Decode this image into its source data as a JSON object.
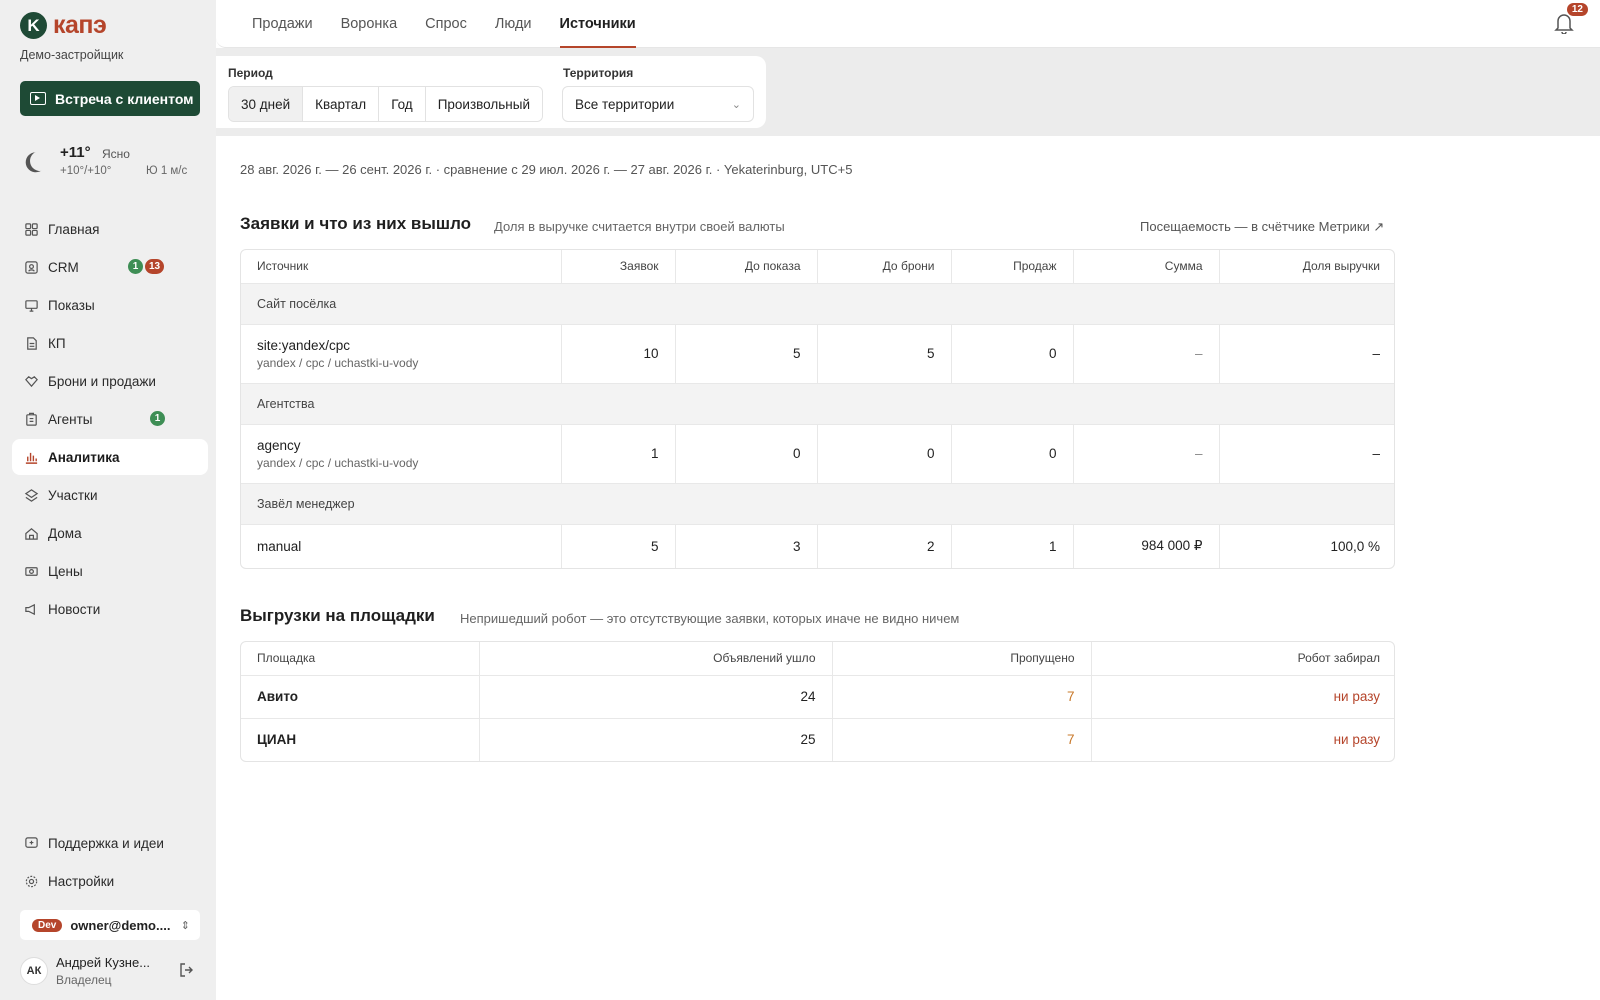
{
  "brand": {
    "logo_letter": "K",
    "logo_text": "капэ",
    "org": "Демо-застройщик"
  },
  "sidebar": {
    "meet_button": "Встреча с клиентом",
    "weather": {
      "temp": "+11°",
      "condition": "Ясно",
      "range": "+10°/+10°",
      "wind": "Ю 1 м/с"
    },
    "items": [
      {
        "label": "Главная",
        "icon": "grid-icon"
      },
      {
        "label": "CRM",
        "icon": "contact-icon",
        "badge_green": "1",
        "badge_red": "13"
      },
      {
        "label": "Показы",
        "icon": "screen-icon"
      },
      {
        "label": "КП",
        "icon": "document-icon"
      },
      {
        "label": "Брони и продажи",
        "icon": "handshake-icon"
      },
      {
        "label": "Агенты",
        "icon": "building-icon",
        "badge_green": "1"
      },
      {
        "label": "Аналитика",
        "icon": "chart-icon",
        "active": true
      },
      {
        "label": "Участки",
        "icon": "plots-icon"
      },
      {
        "label": "Дома",
        "icon": "house-icon"
      },
      {
        "label": "Цены",
        "icon": "price-icon"
      },
      {
        "label": "Новости",
        "icon": "megaphone-icon"
      }
    ],
    "support": "Поддержка и идеи",
    "settings": "Настройки",
    "account": {
      "tag": "Dev",
      "email": "owner@demo...."
    },
    "user": {
      "initials": "АК",
      "name": "Андрей Кузне...",
      "role": "Владелец"
    }
  },
  "tabs": [
    "Продажи",
    "Воронка",
    "Спрос",
    "Люди",
    "Источники"
  ],
  "active_tab": "Источники",
  "notifications": {
    "count": "12"
  },
  "filters": {
    "period_label": "Период",
    "periods": [
      "30 дней",
      "Квартал",
      "Год",
      "Произвольный"
    ],
    "active_period": "30 дней",
    "territory_label": "Территория",
    "territory_value": "Все территории"
  },
  "date_range": "28 авг. 2026 г. — 26 сент. 2026 г. · сравнение с 29 июл. 2026 г. — 27 авг. 2026 г. · Yekaterinburg, UTC+5",
  "leads": {
    "title": "Заявки и что из них вышло",
    "subtitle": "Доля в выручке считается внутри своей валюты",
    "link": "Посещаемость — в счётчике Метрики ↗",
    "columns": [
      "Источник",
      "Заявок",
      "До показа",
      "До брони",
      "Продаж",
      "Сумма",
      "Доля выручки"
    ],
    "groups": [
      {
        "name": "Сайт посёлка",
        "rows": [
          {
            "source": "site:yandex/cpc",
            "utm": "yandex / cpc / uchastki-u-vody",
            "leads": "10",
            "to_show": "5",
            "to_booking": "5",
            "sales": "0",
            "sum": "–",
            "share": "–"
          }
        ]
      },
      {
        "name": "Агентства",
        "rows": [
          {
            "source": "agency",
            "utm": "yandex / cpc / uchastki-u-vody",
            "leads": "1",
            "to_show": "0",
            "to_booking": "0",
            "sales": "0",
            "sum": "–",
            "share": "–"
          }
        ]
      },
      {
        "name": "Завёл менеджер",
        "rows": [
          {
            "source": "manual",
            "utm": "",
            "leads": "5",
            "to_show": "3",
            "to_booking": "2",
            "sales": "1",
            "sum": "984 000 ₽",
            "share": "100,0 %"
          }
        ]
      }
    ]
  },
  "exports": {
    "title": "Выгрузки на площадки",
    "subtitle": "Непришедший робот — это отсутствующие заявки, которых иначе не видно ничем",
    "columns": [
      "Площадка",
      "Объявлений ушло",
      "Пропущено",
      "Робот забирал"
    ],
    "rows": [
      {
        "platform": "Авито",
        "sent": "24",
        "skipped": "7",
        "robot": "ни разу"
      },
      {
        "platform": "ЦИАН",
        "sent": "25",
        "skipped": "7",
        "robot": "ни разу"
      }
    ]
  },
  "colors": {
    "brand_green": "#1e4a35",
    "accent": "#b5452b",
    "badge_green": "#3e8e55",
    "skipped_orange": "#c8782a"
  }
}
